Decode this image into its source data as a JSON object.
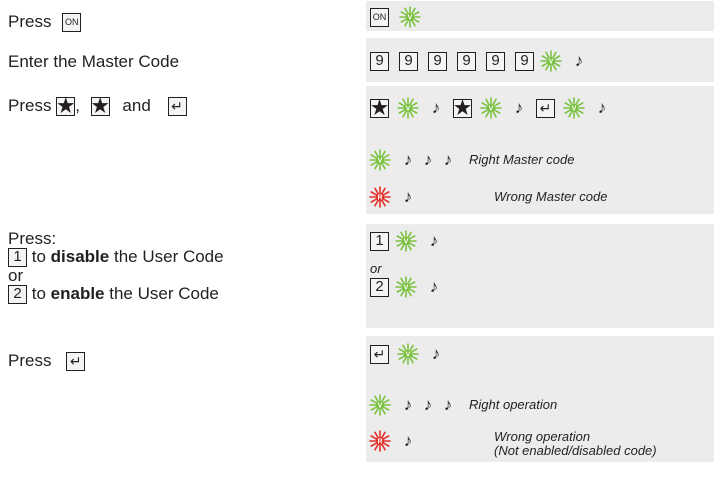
{
  "steps": {
    "s1_prefix": "Press",
    "s2_label": "Enter the Master Code",
    "s3_prefix": "Press",
    "s3_comma": ",",
    "s3_and": "and",
    "s4_title": "Press:",
    "s4_to1": "to",
    "s4_disable": "disable",
    "s4_user1": "the User Code",
    "s4_or": "or",
    "s4_to2": "to",
    "s4_enable": "enable",
    "s4_user2": "the User Code",
    "s5_prefix": "Press"
  },
  "keys": {
    "on": "ON",
    "nine": "9",
    "star": "★",
    "enter": "↵",
    "one": "1",
    "two": "2"
  },
  "leds": {
    "green_letter": "V",
    "red_letter": "R"
  },
  "colors": {
    "green": "#7bc242",
    "red": "#e2302b",
    "panel": "#ececec"
  },
  "icons": {
    "beep": "♪"
  },
  "panel": {
    "master_right": "Right Master code",
    "master_wrong": "Wrong Master code",
    "or": "or",
    "op_right": "Right operation",
    "op_wrong_1": "Wrong operation",
    "op_wrong_2": "(Not enabled/disabled code)"
  }
}
